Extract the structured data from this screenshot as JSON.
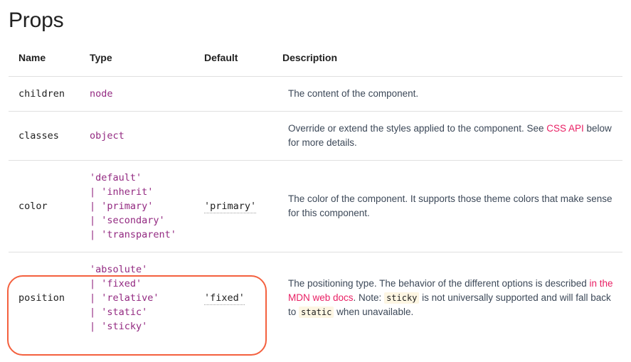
{
  "page": {
    "title": "Props"
  },
  "colors": {
    "type_purple": "#932981",
    "link_pink": "#e91e63",
    "highlight_border": "#f4603e",
    "inline_code_bg": "#fdf6e3",
    "divider": "#e0e0e0",
    "text": "#212121"
  },
  "table": {
    "columns": [
      {
        "key": "name",
        "label": "Name"
      },
      {
        "key": "type",
        "label": "Type"
      },
      {
        "key": "default",
        "label": "Default"
      },
      {
        "key": "description",
        "label": "Description"
      }
    ],
    "rows": [
      {
        "name": "children",
        "type": "node",
        "default": "",
        "description_text": "The content of the component.",
        "description_parts": [
          {
            "kind": "text",
            "text": "The content of the component."
          }
        ]
      },
      {
        "name": "classes",
        "type": "object",
        "default": "",
        "description_text": "Override or extend the styles applied to the component. See CSS API below for more details.",
        "description_parts": [
          {
            "kind": "text",
            "text": "Override or extend the styles applied to the component. See "
          },
          {
            "kind": "link",
            "text": "CSS API"
          },
          {
            "kind": "text",
            "text": " below for more details."
          }
        ]
      },
      {
        "name": "color",
        "type": "'default'\n| 'inherit'\n| 'primary'\n| 'secondary'\n| 'transparent'",
        "default": "'primary'",
        "description_text": "The color of the component. It supports those theme colors that make sense for this component.",
        "description_parts": [
          {
            "kind": "text",
            "text": "The color of the component. It supports those theme colors that make sense for this component."
          }
        ]
      },
      {
        "name": "position",
        "type": "'absolute'\n| 'fixed'\n| 'relative'\n| 'static'\n| 'sticky'",
        "default": "'fixed'",
        "description_text": "The positioning type. The behavior of the different options is described in the MDN web docs. Note: sticky is not universally supported and will fall back to static when unavailable.",
        "description_parts": [
          {
            "kind": "text",
            "text": "The positioning type. The behavior of the different options is described "
          },
          {
            "kind": "link",
            "text": "in the MDN web docs"
          },
          {
            "kind": "text",
            "text": ". Note: "
          },
          {
            "kind": "code",
            "text": "sticky"
          },
          {
            "kind": "text",
            "text": " is not universally supported and will fall back to "
          },
          {
            "kind": "code",
            "text": "static"
          },
          {
            "kind": "text",
            "text": " when unavailable."
          }
        ],
        "highlighted": true
      }
    ]
  },
  "annotation": {
    "highlight_target": "position-row-name-type-default"
  }
}
